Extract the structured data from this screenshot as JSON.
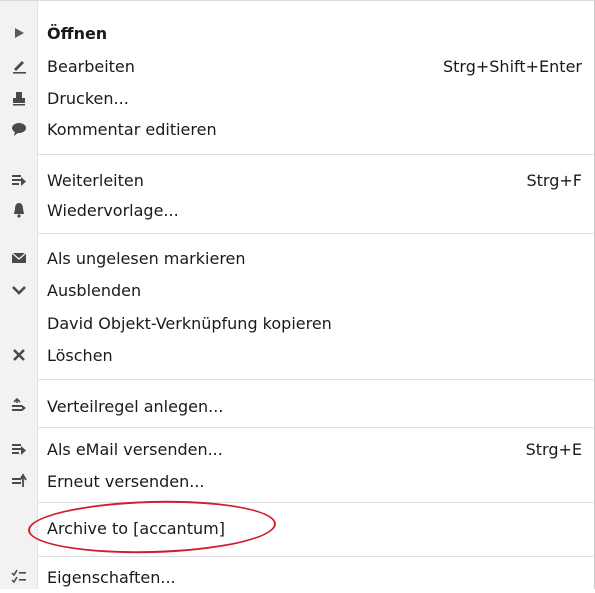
{
  "menu": {
    "items": [
      {
        "label": "Öffnen",
        "shortcut": "",
        "icon": "play-arrow-icon"
      },
      {
        "label": "Bearbeiten",
        "shortcut": "Strg+Shift+Enter",
        "icon": "pencil-icon"
      },
      {
        "label": "Drucken...",
        "shortcut": "",
        "icon": "printer-icon"
      },
      {
        "label": "Kommentar editieren",
        "shortcut": "",
        "icon": "speech-bubble-icon"
      },
      {
        "label": "Weiterleiten",
        "shortcut": "Strg+F",
        "icon": "forward-icon"
      },
      {
        "label": "Wiedervorlage...",
        "shortcut": "",
        "icon": "bell-icon"
      },
      {
        "label": "Als ungelesen markieren",
        "shortcut": "",
        "icon": "envelope-icon"
      },
      {
        "label": "Ausblenden",
        "shortcut": "",
        "icon": "chevron-down-icon"
      },
      {
        "label": "David Objekt-Verknüpfung kopieren",
        "shortcut": "",
        "icon": ""
      },
      {
        "label": "Löschen",
        "shortcut": "",
        "icon": "close-icon"
      },
      {
        "label": "Verteilregel anlegen...",
        "shortcut": "",
        "icon": "distribution-rule-icon"
      },
      {
        "label": "Als eMail versenden...",
        "shortcut": "Strg+E",
        "icon": "send-mail-icon"
      },
      {
        "label": "Erneut versenden...",
        "shortcut": "",
        "icon": "resend-icon"
      },
      {
        "label": "Archive to [accantum]",
        "shortcut": "",
        "icon": ""
      },
      {
        "label": "Eigenschaften...",
        "shortcut": "",
        "icon": "properties-icon"
      }
    ]
  },
  "colors": {
    "highlight_circle": "#d21e2a",
    "icon": "#4a4a4a"
  }
}
